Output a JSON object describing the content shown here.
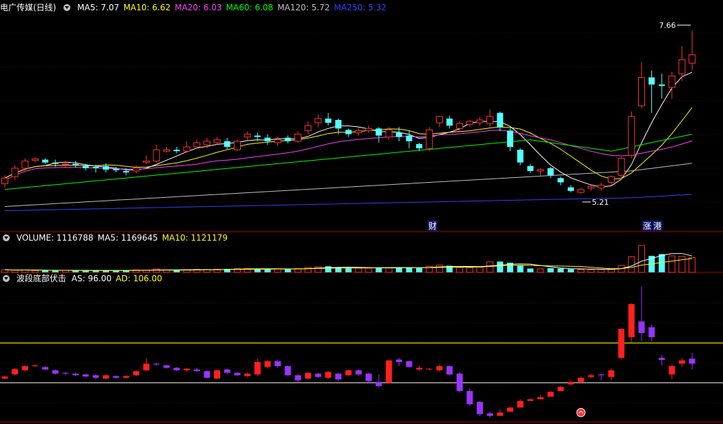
{
  "main_panel": {
    "title": "电广传媒(日线)",
    "indicators": [
      {
        "label": "MA5: 7.07",
        "color": "#ffffff"
      },
      {
        "label": "MA10: 6.62",
        "color": "#ffff00"
      },
      {
        "label": "MA20: 6.03",
        "color": "#ff40ff"
      },
      {
        "label": "MA60: 6.08",
        "color": "#00ff00"
      },
      {
        "label": "MA120: 5.72",
        "color": "#c0c0c0"
      },
      {
        "label": "MA250: 5.32",
        "color": "#3040ff"
      }
    ],
    "high_label": "7.66",
    "low_label": "5.21",
    "event_marker_1": "财",
    "event_marker_2": "涨",
    "event_marker_3": "港"
  },
  "volume_panel": {
    "indicators": [
      {
        "label": "VOLUME: 1116788",
        "color": "#ffffff"
      },
      {
        "label": "MA5: 1169645",
        "color": "#ffffff"
      },
      {
        "label": "MA10: 1121179",
        "color": "#ffff00"
      }
    ]
  },
  "indicator_panel": {
    "title": "波段底部伏击",
    "indicators": [
      {
        "label": "AS: 96.00",
        "color": "#ffffff"
      },
      {
        "label": "AD: 106.00",
        "color": "#ffff00"
      }
    ]
  },
  "colors": {
    "up": "#ff3232",
    "down": "#54ffff",
    "ind_up": "#ff2020",
    "ind_down": "#9933ff",
    "panel_border": "#b00000",
    "grid": "#5a0000"
  },
  "chart_data": {
    "type": "candlestick",
    "price_ylim": [
      5.0,
      7.8
    ],
    "candles": [
      [
        5.5,
        5.58,
        5.45,
        5.62
      ],
      [
        5.6,
        5.72,
        5.56,
        5.76
      ],
      [
        5.72,
        5.82,
        5.68,
        5.86
      ],
      [
        5.83,
        5.85,
        5.8,
        5.88
      ],
      [
        5.84,
        5.8,
        5.78,
        5.86
      ],
      [
        5.8,
        5.78,
        5.74,
        5.84
      ],
      [
        5.77,
        5.78,
        5.72,
        5.82
      ],
      [
        5.78,
        5.76,
        5.73,
        5.82
      ],
      [
        5.76,
        5.72,
        5.69,
        5.78
      ],
      [
        5.74,
        5.72,
        5.66,
        5.77
      ],
      [
        5.75,
        5.7,
        5.66,
        5.79
      ],
      [
        5.71,
        5.69,
        5.66,
        5.74
      ],
      [
        5.68,
        5.66,
        5.62,
        5.72
      ],
      [
        5.68,
        5.72,
        5.65,
        5.76
      ],
      [
        5.8,
        5.82,
        5.78,
        5.9
      ],
      [
        5.82,
        5.98,
        5.8,
        6.05
      ],
      [
        5.96,
        5.98,
        5.94,
        6.02
      ],
      [
        5.98,
        5.96,
        5.93,
        6.02
      ],
      [
        5.96,
        6.02,
        5.94,
        6.1
      ],
      [
        6.02,
        6.08,
        6.0,
        6.12
      ],
      [
        6.05,
        6.1,
        6.0,
        6.15
      ],
      [
        6.08,
        6.12,
        6.05,
        6.16
      ],
      [
        6.1,
        6.02,
        5.98,
        6.15
      ],
      [
        5.98,
        6.1,
        5.96,
        6.12
      ],
      [
        6.16,
        6.2,
        6.12,
        6.24
      ],
      [
        6.18,
        6.16,
        6.1,
        6.22
      ],
      [
        6.15,
        6.1,
        6.05,
        6.2
      ],
      [
        6.08,
        6.12,
        6.04,
        6.16
      ],
      [
        6.15,
        6.1,
        6.07,
        6.18
      ],
      [
        6.1,
        6.2,
        6.08,
        6.24
      ],
      [
        6.25,
        6.32,
        6.2,
        6.38
      ],
      [
        6.36,
        6.42,
        6.3,
        6.48
      ],
      [
        6.42,
        6.36,
        6.32,
        6.5
      ],
      [
        6.4,
        6.28,
        6.2,
        6.42
      ],
      [
        6.26,
        6.2,
        6.16,
        6.28
      ],
      [
        6.22,
        6.25,
        6.18,
        6.3
      ],
      [
        6.25,
        6.28,
        6.22,
        6.32
      ],
      [
        6.28,
        6.18,
        6.08,
        6.3
      ],
      [
        6.16,
        6.26,
        6.12,
        6.3
      ],
      [
        6.22,
        6.16,
        6.1,
        6.3
      ],
      [
        6.18,
        6.1,
        6.0,
        6.25
      ],
      [
        6.06,
        6.0,
        5.96,
        6.08
      ],
      [
        6.0,
        6.26,
        5.96,
        6.3
      ],
      [
        6.36,
        6.45,
        6.3,
        6.46
      ],
      [
        6.42,
        6.32,
        6.28,
        6.46
      ],
      [
        6.28,
        6.35,
        6.25,
        6.38
      ],
      [
        6.34,
        6.38,
        6.3,
        6.4
      ],
      [
        6.36,
        6.4,
        6.32,
        6.44
      ],
      [
        6.35,
        6.45,
        6.3,
        6.55
      ],
      [
        6.5,
        6.3,
        6.24,
        6.52
      ],
      [
        6.25,
        6.02,
        5.96,
        6.28
      ],
      [
        5.98,
        5.8,
        5.76,
        6.0
      ],
      [
        5.75,
        5.68,
        5.65,
        5.78
      ],
      [
        5.68,
        5.7,
        5.62,
        5.72
      ],
      [
        5.72,
        5.62,
        5.58,
        5.74
      ],
      [
        5.58,
        5.52,
        5.48,
        5.6
      ],
      [
        5.45,
        5.4,
        5.38,
        5.48
      ],
      [
        5.38,
        5.42,
        5.36,
        5.44
      ],
      [
        5.44,
        5.46,
        5.4,
        5.48
      ],
      [
        5.44,
        5.48,
        5.4,
        5.52
      ],
      [
        5.52,
        5.6,
        5.48,
        5.62
      ],
      [
        5.62,
        5.86,
        5.56,
        5.88
      ],
      [
        5.9,
        6.45,
        5.86,
        6.52
      ],
      [
        6.6,
        7.0,
        6.56,
        7.22
      ],
      [
        7.0,
        6.9,
        6.5,
        7.1
      ],
      [
        6.9,
        6.88,
        6.7,
        7.05
      ],
      [
        6.86,
        7.02,
        6.7,
        7.08
      ],
      [
        7.05,
        7.25,
        6.95,
        7.44
      ],
      [
        7.2,
        7.32,
        7.1,
        7.66
      ]
    ],
    "volumes": [
      0.15,
      0.12,
      0.14,
      0.1,
      0.11,
      0.1,
      0.12,
      0.11,
      0.1,
      0.12,
      0.11,
      0.1,
      0.12,
      0.14,
      0.13,
      0.2,
      0.13,
      0.12,
      0.15,
      0.17,
      0.16,
      0.18,
      0.2,
      0.21,
      0.22,
      0.2,
      0.18,
      0.2,
      0.19,
      0.22,
      0.28,
      0.32,
      0.35,
      0.28,
      0.26,
      0.24,
      0.24,
      0.28,
      0.26,
      0.27,
      0.28,
      0.24,
      0.35,
      0.42,
      0.38,
      0.28,
      0.27,
      0.3,
      0.6,
      0.62,
      0.55,
      0.38,
      0.22,
      0.2,
      0.24,
      0.22,
      0.18,
      0.16,
      0.15,
      0.16,
      0.2,
      0.4,
      0.9,
      1.55,
      0.95,
      1.05,
      0.95,
      0.92,
      0.85
    ],
    "indicator_candles": [
      [
        10,
        15,
        8,
        18
      ],
      [
        20,
        33,
        18,
        36
      ],
      [
        30,
        40,
        26,
        42
      ],
      [
        40,
        42,
        38,
        44
      ],
      [
        38,
        32,
        30,
        40
      ],
      [
        30,
        22,
        20,
        32
      ],
      [
        24,
        22,
        18,
        26
      ],
      [
        22,
        18,
        16,
        24
      ],
      [
        20,
        15,
        14,
        22
      ],
      [
        18,
        12,
        8,
        20
      ],
      [
        10,
        18,
        8,
        20
      ],
      [
        16,
        12,
        10,
        18
      ],
      [
        12,
        16,
        10,
        18
      ],
      [
        18,
        28,
        16,
        30
      ],
      [
        30,
        46,
        28,
        60
      ],
      [
        46,
        44,
        40,
        48
      ],
      [
        42,
        36,
        34,
        44
      ],
      [
        36,
        30,
        28,
        38
      ],
      [
        30,
        34,
        26,
        36
      ],
      [
        32,
        28,
        26,
        36
      ],
      [
        28,
        12,
        10,
        30
      ],
      [
        10,
        30,
        8,
        32
      ],
      [
        32,
        24,
        20,
        34
      ],
      [
        24,
        18,
        16,
        26
      ],
      [
        16,
        22,
        14,
        24
      ],
      [
        20,
        50,
        16,
        58
      ],
      [
        38,
        52,
        34,
        54
      ],
      [
        52,
        40,
        36,
        56
      ],
      [
        40,
        18,
        16,
        42
      ],
      [
        18,
        6,
        0,
        22
      ],
      [
        10,
        24,
        8,
        26
      ],
      [
        22,
        14,
        12,
        24
      ],
      [
        12,
        26,
        8,
        28
      ],
      [
        22,
        8,
        4,
        24
      ],
      [
        18,
        30,
        16,
        32
      ],
      [
        30,
        20,
        16,
        32
      ],
      [
        22,
        4,
        0,
        24
      ],
      [
        2,
        -8,
        -12,
        20
      ],
      [
        0,
        54,
        -2,
        56
      ],
      [
        56,
        50,
        40,
        60
      ],
      [
        52,
        38,
        36,
        54
      ],
      [
        32,
        36,
        28,
        40
      ],
      [
        34,
        34,
        30,
        36
      ],
      [
        30,
        40,
        26,
        44
      ],
      [
        40,
        20,
        18,
        42
      ],
      [
        22,
        -20,
        -24,
        26
      ],
      [
        -20,
        -52,
        -55,
        -14
      ],
      [
        -46,
        -76,
        -80,
        -44
      ],
      [
        -74,
        -80,
        -84,
        -70
      ],
      [
        -80,
        -72,
        -76,
        -64
      ],
      [
        -70,
        -60,
        -64,
        -58
      ],
      [
        -60,
        -44,
        -48,
        -40
      ],
      [
        -44,
        -40,
        -42,
        -38
      ],
      [
        -40,
        -35,
        -38,
        -30
      ],
      [
        -34,
        -22,
        -26,
        -20
      ],
      [
        -20,
        -10,
        -14,
        -8
      ],
      [
        -4,
        2,
        -6,
        6
      ],
      [
        2,
        12,
        -2,
        16
      ],
      [
        14,
        18,
        10,
        22
      ],
      [
        20,
        18,
        6,
        22
      ],
      [
        14,
        30,
        6,
        34
      ],
      [
        60,
        130,
        56,
        132
      ],
      [
        110,
        190,
        98,
        192
      ],
      [
        148,
        120,
        100,
        232
      ],
      [
        134,
        110,
        100,
        140
      ],
      [
        60,
        55,
        42,
        68
      ],
      [
        20,
        40,
        8,
        44
      ],
      [
        46,
        54,
        38,
        60
      ],
      [
        58,
        46,
        32,
        72
      ]
    ],
    "indicator_ylim": [
      -88,
      230
    ],
    "indicator_hlines": [
      {
        "value": 96,
        "color": "#ffff00"
      },
      {
        "value": 0,
        "color": "#ffffff"
      }
    ]
  }
}
